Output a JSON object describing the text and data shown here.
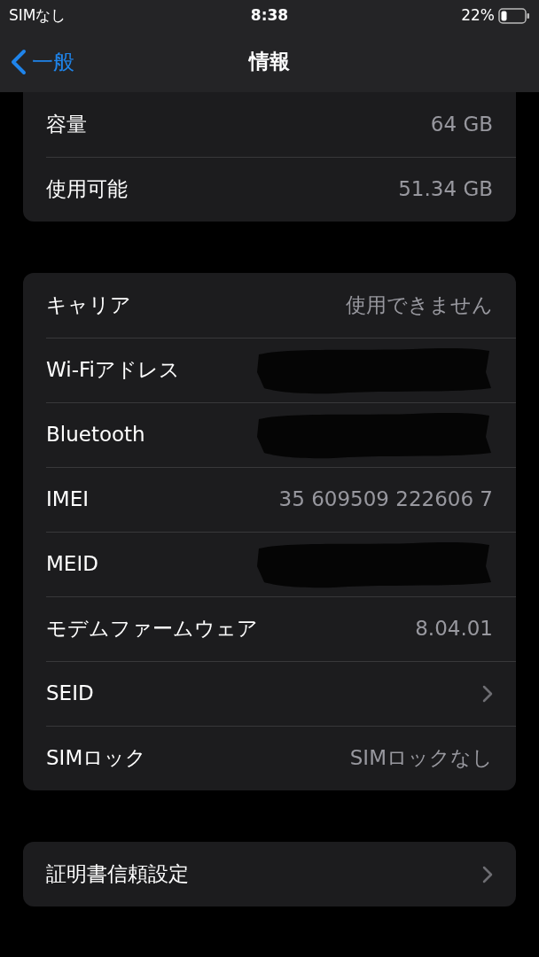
{
  "status_bar": {
    "carrier": "SIMなし",
    "time": "8:38",
    "battery": "22%"
  },
  "nav": {
    "back": "一般",
    "title": "情報"
  },
  "groups": [
    {
      "clipped": true,
      "rows": [
        {
          "kind": "value",
          "label": "容量",
          "value": "64 GB"
        },
        {
          "kind": "value",
          "label": "使用可能",
          "value": "51.34 GB"
        }
      ]
    },
    {
      "clipped": false,
      "rows": [
        {
          "kind": "value",
          "label": "キャリア",
          "value": "使用できません"
        },
        {
          "kind": "redacted",
          "label": "Wi-Fiアドレス"
        },
        {
          "kind": "redacted",
          "label": "Bluetooth"
        },
        {
          "kind": "value",
          "label": "IMEI",
          "value": "35 609509 222606 7"
        },
        {
          "kind": "redacted",
          "label": "MEID"
        },
        {
          "kind": "value",
          "label": "モデムファームウェア",
          "value": "8.04.01"
        },
        {
          "kind": "link",
          "label": "SEID"
        },
        {
          "kind": "value",
          "label": "SIMロック",
          "value": "SIMロックなし"
        }
      ]
    },
    {
      "clipped": false,
      "rows": [
        {
          "kind": "link",
          "label": "証明書信頼設定"
        }
      ]
    }
  ]
}
